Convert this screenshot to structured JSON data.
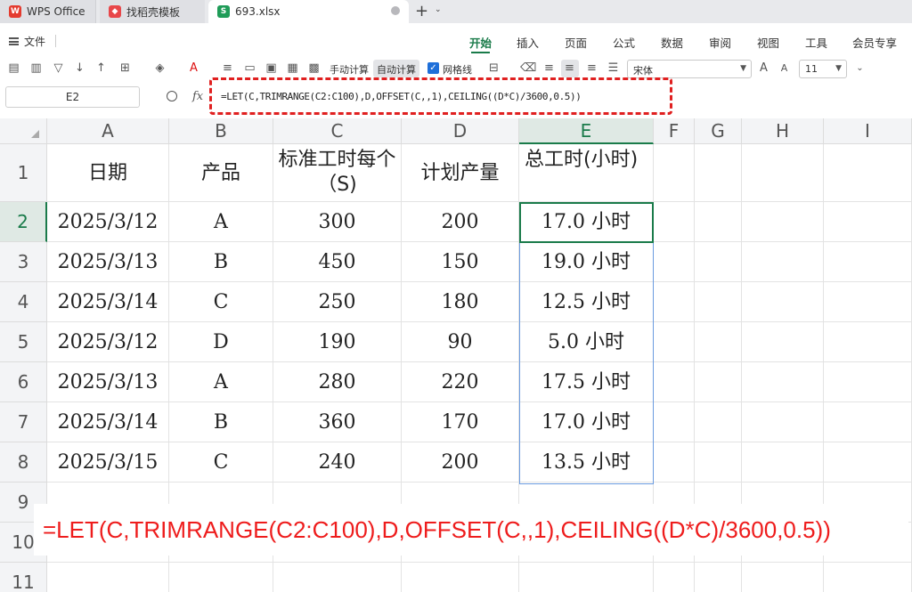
{
  "tabs": [
    {
      "label": "WPS Office",
      "icon": "wps-logo-icon"
    },
    {
      "label": "找稻壳模板",
      "icon": "docer-icon"
    },
    {
      "label": "693.xlsx",
      "icon": "sheet-s-icon",
      "active": true
    }
  ],
  "menu": {
    "file_label": "文件",
    "tabs": [
      "开始",
      "插入",
      "页面",
      "公式",
      "数据",
      "审阅",
      "视图",
      "工具",
      "会员专享"
    ],
    "active_tab": "开始"
  },
  "toolbar": {
    "manual_calc": "手动计算",
    "auto_calc": "自动计算",
    "gridlines_label": "网格线",
    "gridlines_checked": true,
    "font_name": "宋体",
    "font_size": "11"
  },
  "formula_bar": {
    "name_box": "E2",
    "fx_label": "fx",
    "formula": "=LET(C,TRIMRANGE(C2:C100),D,OFFSET(C,,1),CEILING((D*C)/3600,0.5))"
  },
  "sheet": {
    "columns": [
      "A",
      "B",
      "C",
      "D",
      "E",
      "F",
      "G",
      "H",
      "I"
    ],
    "rows": [
      "1",
      "2",
      "3",
      "4",
      "5",
      "6",
      "7",
      "8",
      "9",
      "10",
      "11"
    ],
    "header_row": [
      "日期",
      "产品",
      "标准工时每个（S)",
      "计划产量",
      "总工时(小时)"
    ],
    "data": [
      [
        "2025/3/12",
        "A",
        "300",
        "200",
        "17.0 小时"
      ],
      [
        "2025/3/13",
        "B",
        "450",
        "150",
        "19.0 小时"
      ],
      [
        "2025/3/14",
        "C",
        "250",
        "180",
        "12.5 小时"
      ],
      [
        "2025/3/12",
        "D",
        "190",
        "90",
        "5.0 小时"
      ],
      [
        "2025/3/13",
        "A",
        "280",
        "220",
        "17.5 小时"
      ],
      [
        "2025/3/14",
        "B",
        "360",
        "170",
        "17.0 小时"
      ],
      [
        "2025/3/15",
        "C",
        "240",
        "200",
        "13.5 小时"
      ]
    ],
    "active_cell": "E2",
    "active_column": "E",
    "active_row": "2"
  },
  "overlay_formula": "=LET(C,TRIMRANGE(C2:C100),D,OFFSET(C,,1),CEILING((D*C)/3600,0.5))",
  "colors": {
    "accent_green": "#1a7b4a",
    "highlight_red": "#e02020",
    "selection_blue": "#6a9be0"
  }
}
